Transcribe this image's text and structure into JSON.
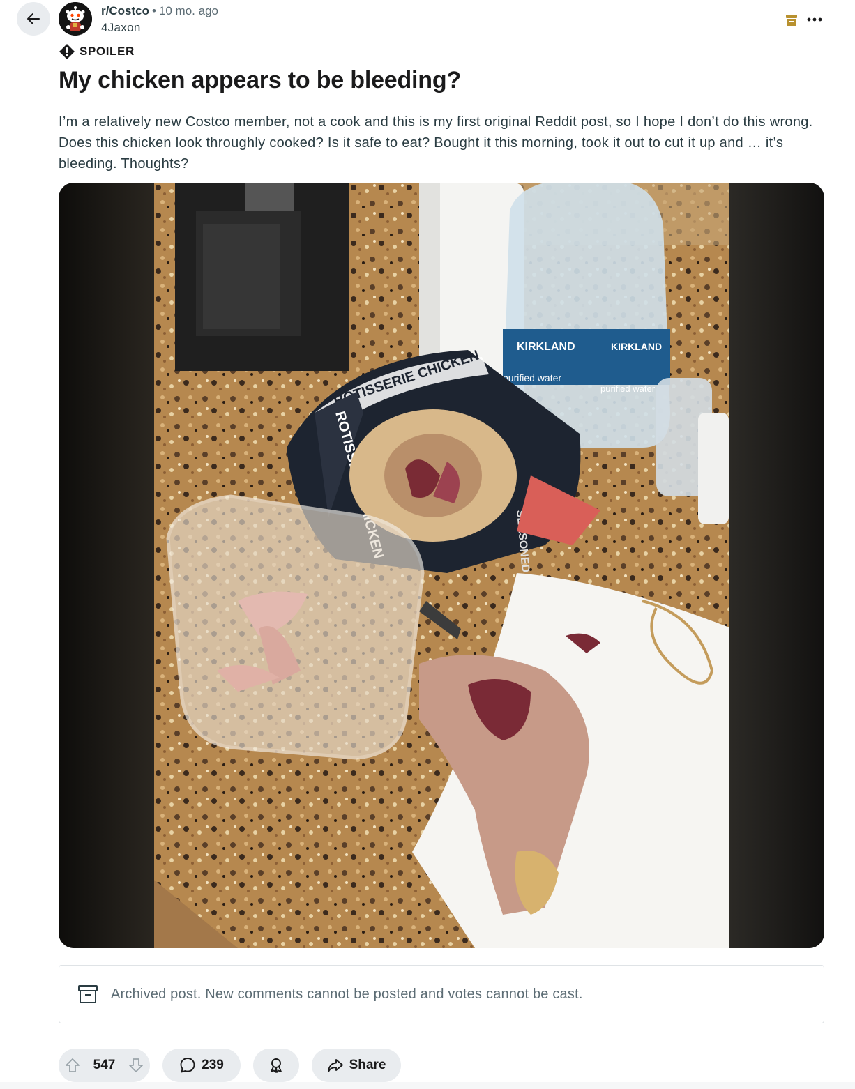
{
  "post": {
    "subreddit": "r/Costco",
    "time": "10 mo. ago",
    "separator": "•",
    "author": "4Jaxon",
    "flair": "SPOILER",
    "title": "My chicken appears to be bleeding?",
    "body": "I’m a relatively new Costco member, not a cook and this is my first original Reddit post, so I hope I don’t do this wrong. Does this chicken look throughly cooked? Is it safe to eat? Bought it this morning, took it out to cut it up and … it’s bleeding. Thoughts?"
  },
  "media": {
    "description_icon": "photo-of-rotisserie-chicken",
    "photo_text": {
      "bag_top": "ROTISSERIE CHICKEN",
      "bag_side": "ROTISSERIE CHICKEN",
      "bag_seasoned": "SEASONED",
      "bottle_brand": "KIRKLAND",
      "bottle_text": "purified water",
      "bottle2_brand": "KIRKLAND",
      "bottle2_text": "purified water"
    }
  },
  "notice": {
    "archived_text": "Archived post. New comments cannot be posted and votes cannot be cast."
  },
  "actions": {
    "vote_count": "547",
    "comment_count": "239",
    "share_label": "Share"
  },
  "icons": {
    "back": "arrow-left-icon",
    "more": "overflow-dots-icon",
    "archive": "archive-box-icon",
    "spoiler": "exclamation-diamond-icon",
    "upvote": "arrow-up-icon",
    "downvote": "arrow-down-icon",
    "comment": "speech-bubble-icon",
    "award": "award-ribbon-icon",
    "share": "share-arrow-icon"
  },
  "colors": {
    "archive_icon": "#b8912f",
    "text_primary": "#1a1a1b",
    "text_secondary": "#5c6c74",
    "pill_bg": "#e9ecef"
  }
}
